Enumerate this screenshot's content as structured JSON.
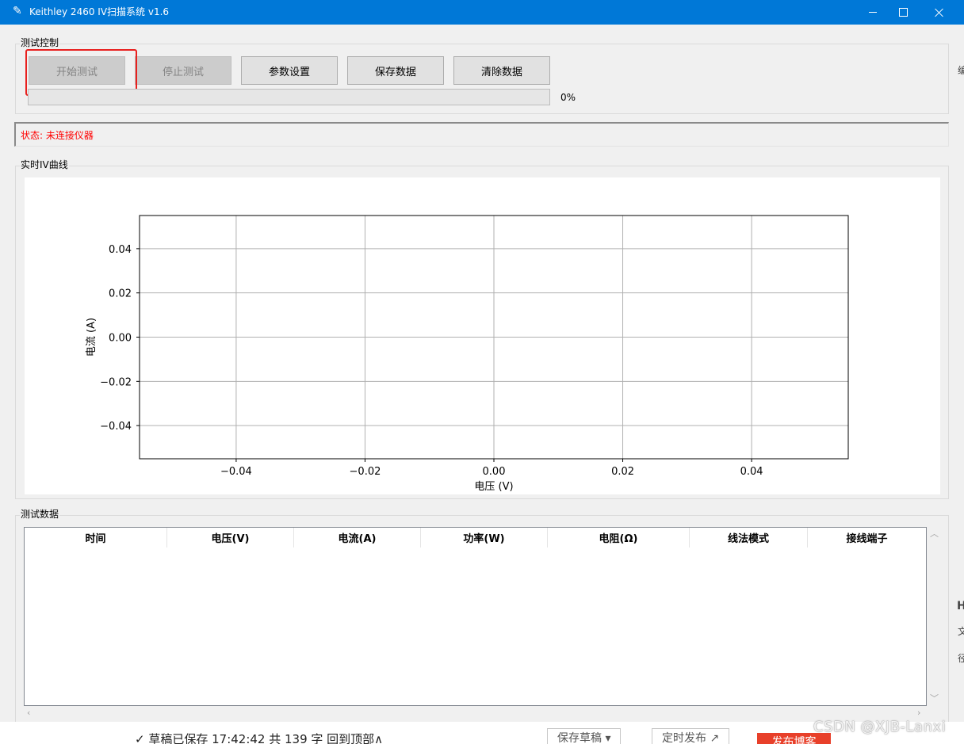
{
  "window": {
    "title": "Keithley 2460 IV扫描系统 v1.6",
    "icon": "feather-icon",
    "controls": [
      "minimize-icon",
      "maximize-icon",
      "close-icon"
    ]
  },
  "control_group": {
    "label": "测试控制",
    "buttons": [
      {
        "label": "开始测试",
        "enabled": false,
        "highlighted": true
      },
      {
        "label": "停止测试",
        "enabled": false
      },
      {
        "label": "参数设置",
        "enabled": true
      },
      {
        "label": "保存数据",
        "enabled": true
      },
      {
        "label": "清除数据",
        "enabled": true
      }
    ],
    "progress": {
      "value": 0,
      "text": "0%"
    }
  },
  "status": {
    "text": "状态: 未连接仪器",
    "color": "#ff0000"
  },
  "chart_group": {
    "label": "实时IV曲线"
  },
  "chart_data": {
    "type": "scatter",
    "title": "",
    "xlabel": "电压 (V)",
    "ylabel": "电流 (A)",
    "xlim": [
      -0.055,
      0.055
    ],
    "ylim": [
      -0.055,
      0.055
    ],
    "xticks": [
      -0.04,
      -0.02,
      0.0,
      0.02,
      0.04
    ],
    "yticks": [
      -0.04,
      -0.02,
      0.0,
      0.02,
      0.04
    ],
    "xtick_labels": [
      "−0.04",
      "−0.02",
      "0.00",
      "0.02",
      "0.04"
    ],
    "ytick_labels": [
      "−0.04",
      "−0.02",
      "0.00",
      "0.02",
      "0.04"
    ],
    "grid": true,
    "series": [
      {
        "x": [],
        "y": []
      }
    ]
  },
  "data_group": {
    "label": "测试数据",
    "columns": [
      "时间",
      "电压(V)",
      "电流(A)",
      "功率(W)",
      "电阻(Ω)",
      "线法模式",
      "接线端子"
    ],
    "rows": []
  },
  "background_window": {
    "status_text": "✓ 草稿已保存 17:42:42  共 139 字  回到顶部∧",
    "save_draft_button": "保存草稿 ▾",
    "schedule_button": "定时发布 ↗",
    "publish_button": "发布博客",
    "watermark": "CSDN @XJB-Lanxi",
    "edge_glyphs": [
      "编",
      "H",
      "文",
      "径",
      "径"
    ]
  }
}
